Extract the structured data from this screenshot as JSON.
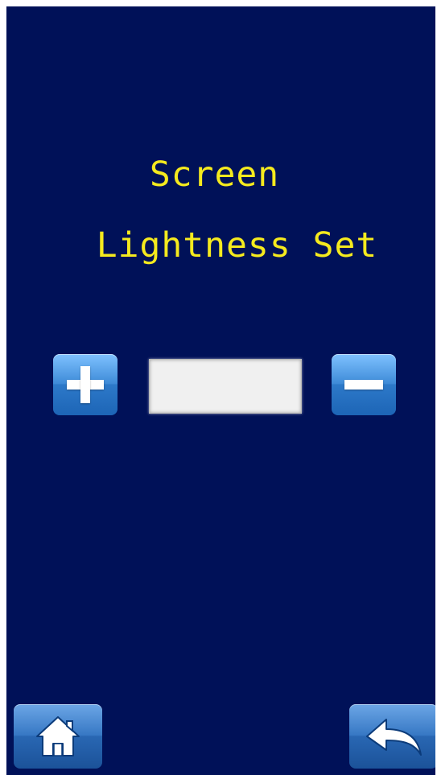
{
  "screen": {
    "title_line_1": "Screen",
    "title_line_2": "Lightness Set",
    "lightness_value": ""
  },
  "controls": {
    "increase_icon": "plus-icon",
    "decrease_icon": "minus-icon"
  },
  "navigation": {
    "home_icon": "home-icon",
    "back_icon": "back-arrow-icon"
  },
  "colors": {
    "background": "#001158",
    "title": "#f5ea1e",
    "button_blue": "#3e8bd8",
    "value_box": "#f0f0f0"
  }
}
